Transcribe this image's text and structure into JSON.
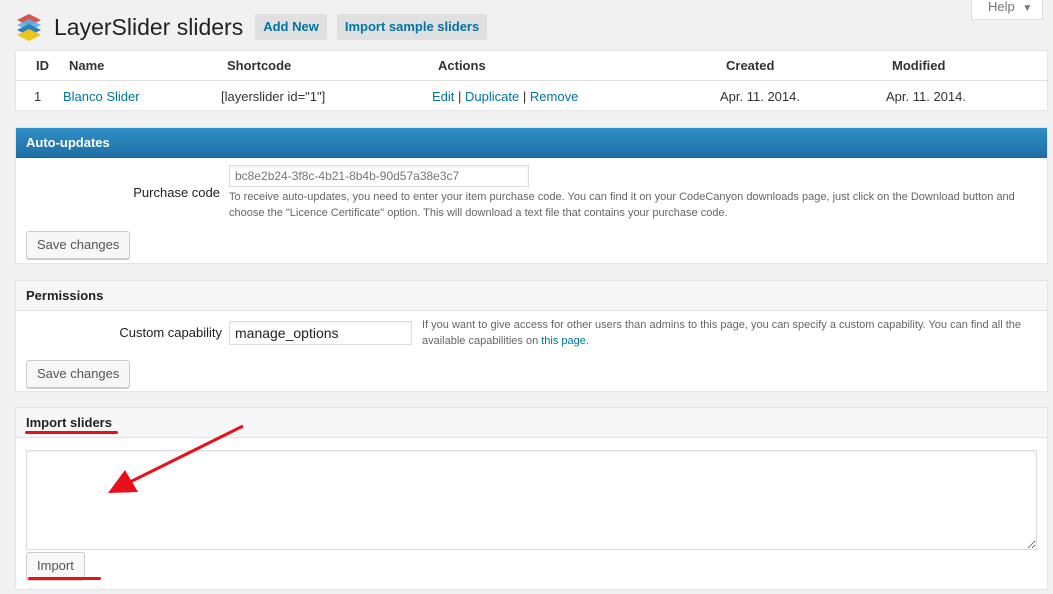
{
  "header": {
    "title": "LayerSlider sliders",
    "add_new": "Add New",
    "import_sample": "Import sample sliders",
    "help": "Help",
    "help_arrow": "▼"
  },
  "slider_table": {
    "columns": [
      "ID",
      "Name",
      "Shortcode",
      "Actions",
      "Created",
      "Modified"
    ],
    "rows": [
      {
        "id": "1",
        "name": "Blanco Slider",
        "shortcode": "[layerslider id=\"1\"]",
        "actions": {
          "edit": "Edit",
          "duplicate": "Duplicate",
          "remove": "Remove",
          "sep": "|"
        },
        "created": "Apr. 11. 2014.",
        "modified": "Apr. 11. 2014."
      }
    ]
  },
  "auto_updates": {
    "title": "Auto-updates",
    "label": "Purchase code",
    "placeholder": "bc8e2b24-3f8c-4b21-8b4b-90d57a38e3c7",
    "hint": "To receive auto-updates, you need to enter your item purchase code. You can find it on your CodeCanyon downloads page, just click on the Download button and choose the \"Licence Certificate\" option. This will download a text file that contains your purchase code.",
    "save": "Save changes"
  },
  "permissions": {
    "title": "Permissions",
    "label": "Custom capability",
    "value": "manage_options",
    "hint_pre": "If you want to give access for other users than admins to this page, you can specify a custom capability. You can find all the available capabilities on ",
    "hint_link": "this page",
    "hint_post": ".",
    "save": "Save changes"
  },
  "import": {
    "title": "Import sliders",
    "textarea_value": "",
    "button": "Import"
  },
  "colors": {
    "accent": "#0074a2",
    "panel_head_blue": "#2280b8",
    "annotation_red": "#e8101b"
  }
}
